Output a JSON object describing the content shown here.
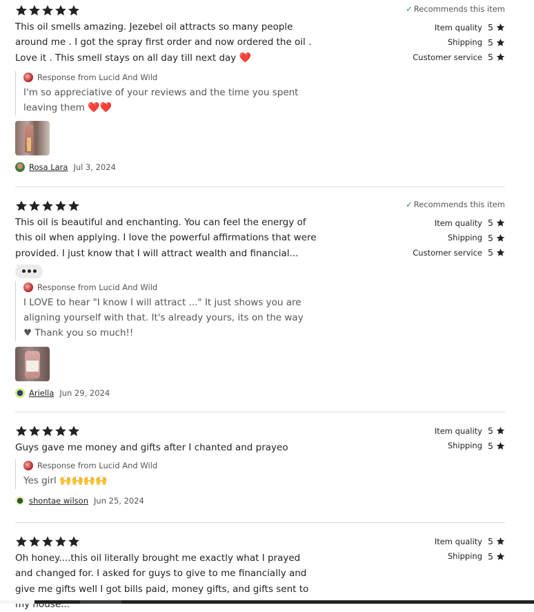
{
  "reviews": [
    {
      "rating": 5,
      "recommends": "Recommends this item",
      "text": "This oil smells amazing. Jezebel oil attracts so many people around me . I got the spray first order and now ordered the oil . Love it . This smell stays on all day till next day",
      "text_emoji": "❤️",
      "response_label": "Response from Lucid And Wild",
      "response_text": "I'm so appreciative of your reviews and the time you spent leaving them",
      "response_emoji": "❤️❤️",
      "reviewer": "Rosa Lara",
      "date": "Jul 3, 2024",
      "ratings": [
        {
          "label": "Item quality",
          "value": "5"
        },
        {
          "label": "Shipping",
          "value": "5"
        },
        {
          "label": "Customer service",
          "value": "5"
        }
      ]
    },
    {
      "rating": 5,
      "recommends": "Recommends this item",
      "text": "This oil is beautiful and enchanting. You can feel the energy of this oil when applying. I love the powerful affirmations that were provided. I just know that I will attract wealth and financial...",
      "response_label": "Response from Lucid And Wild",
      "response_text": "I LOVE to hear \"I know I will attract ...\" It just shows you are aligning yourself with that. It's already yours, its on the way ♥ Thank you so much!!",
      "reviewer": "Ariella",
      "date": "Jun 29, 2024",
      "ratings": [
        {
          "label": "Item quality",
          "value": "5"
        },
        {
          "label": "Shipping",
          "value": "5"
        },
        {
          "label": "Customer service",
          "value": "5"
        }
      ]
    },
    {
      "rating": 5,
      "text": "Guys gave me money and gifts after I chanted and prayeo",
      "response_label": "Response from Lucid And Wild",
      "response_text": "Yes girl",
      "response_emoji": "🙌🙌🙌🙌",
      "reviewer": "shontae wilson",
      "date": "Jun 25, 2024",
      "ratings": [
        {
          "label": "Item quality",
          "value": "5"
        },
        {
          "label": "Shipping",
          "value": "5"
        }
      ]
    },
    {
      "rating": 5,
      "text": "Oh honey....this oil literally brought me exactly what I prayed and changed for. I asked for guys to give to me financially and give me gifts well I got bills paid, money gifts, and gifts sent to my house...",
      "ratings": [
        {
          "label": "Item quality",
          "value": "5"
        },
        {
          "label": "Shipping",
          "value": "5"
        }
      ]
    }
  ],
  "colors": {
    "star": "#222222",
    "check": "#2e8b57",
    "heart": "#e0242b",
    "divider": "#dddddd"
  },
  "icons": {
    "star": "star-icon",
    "check": "check-icon",
    "more": "more-dots-icon"
  }
}
